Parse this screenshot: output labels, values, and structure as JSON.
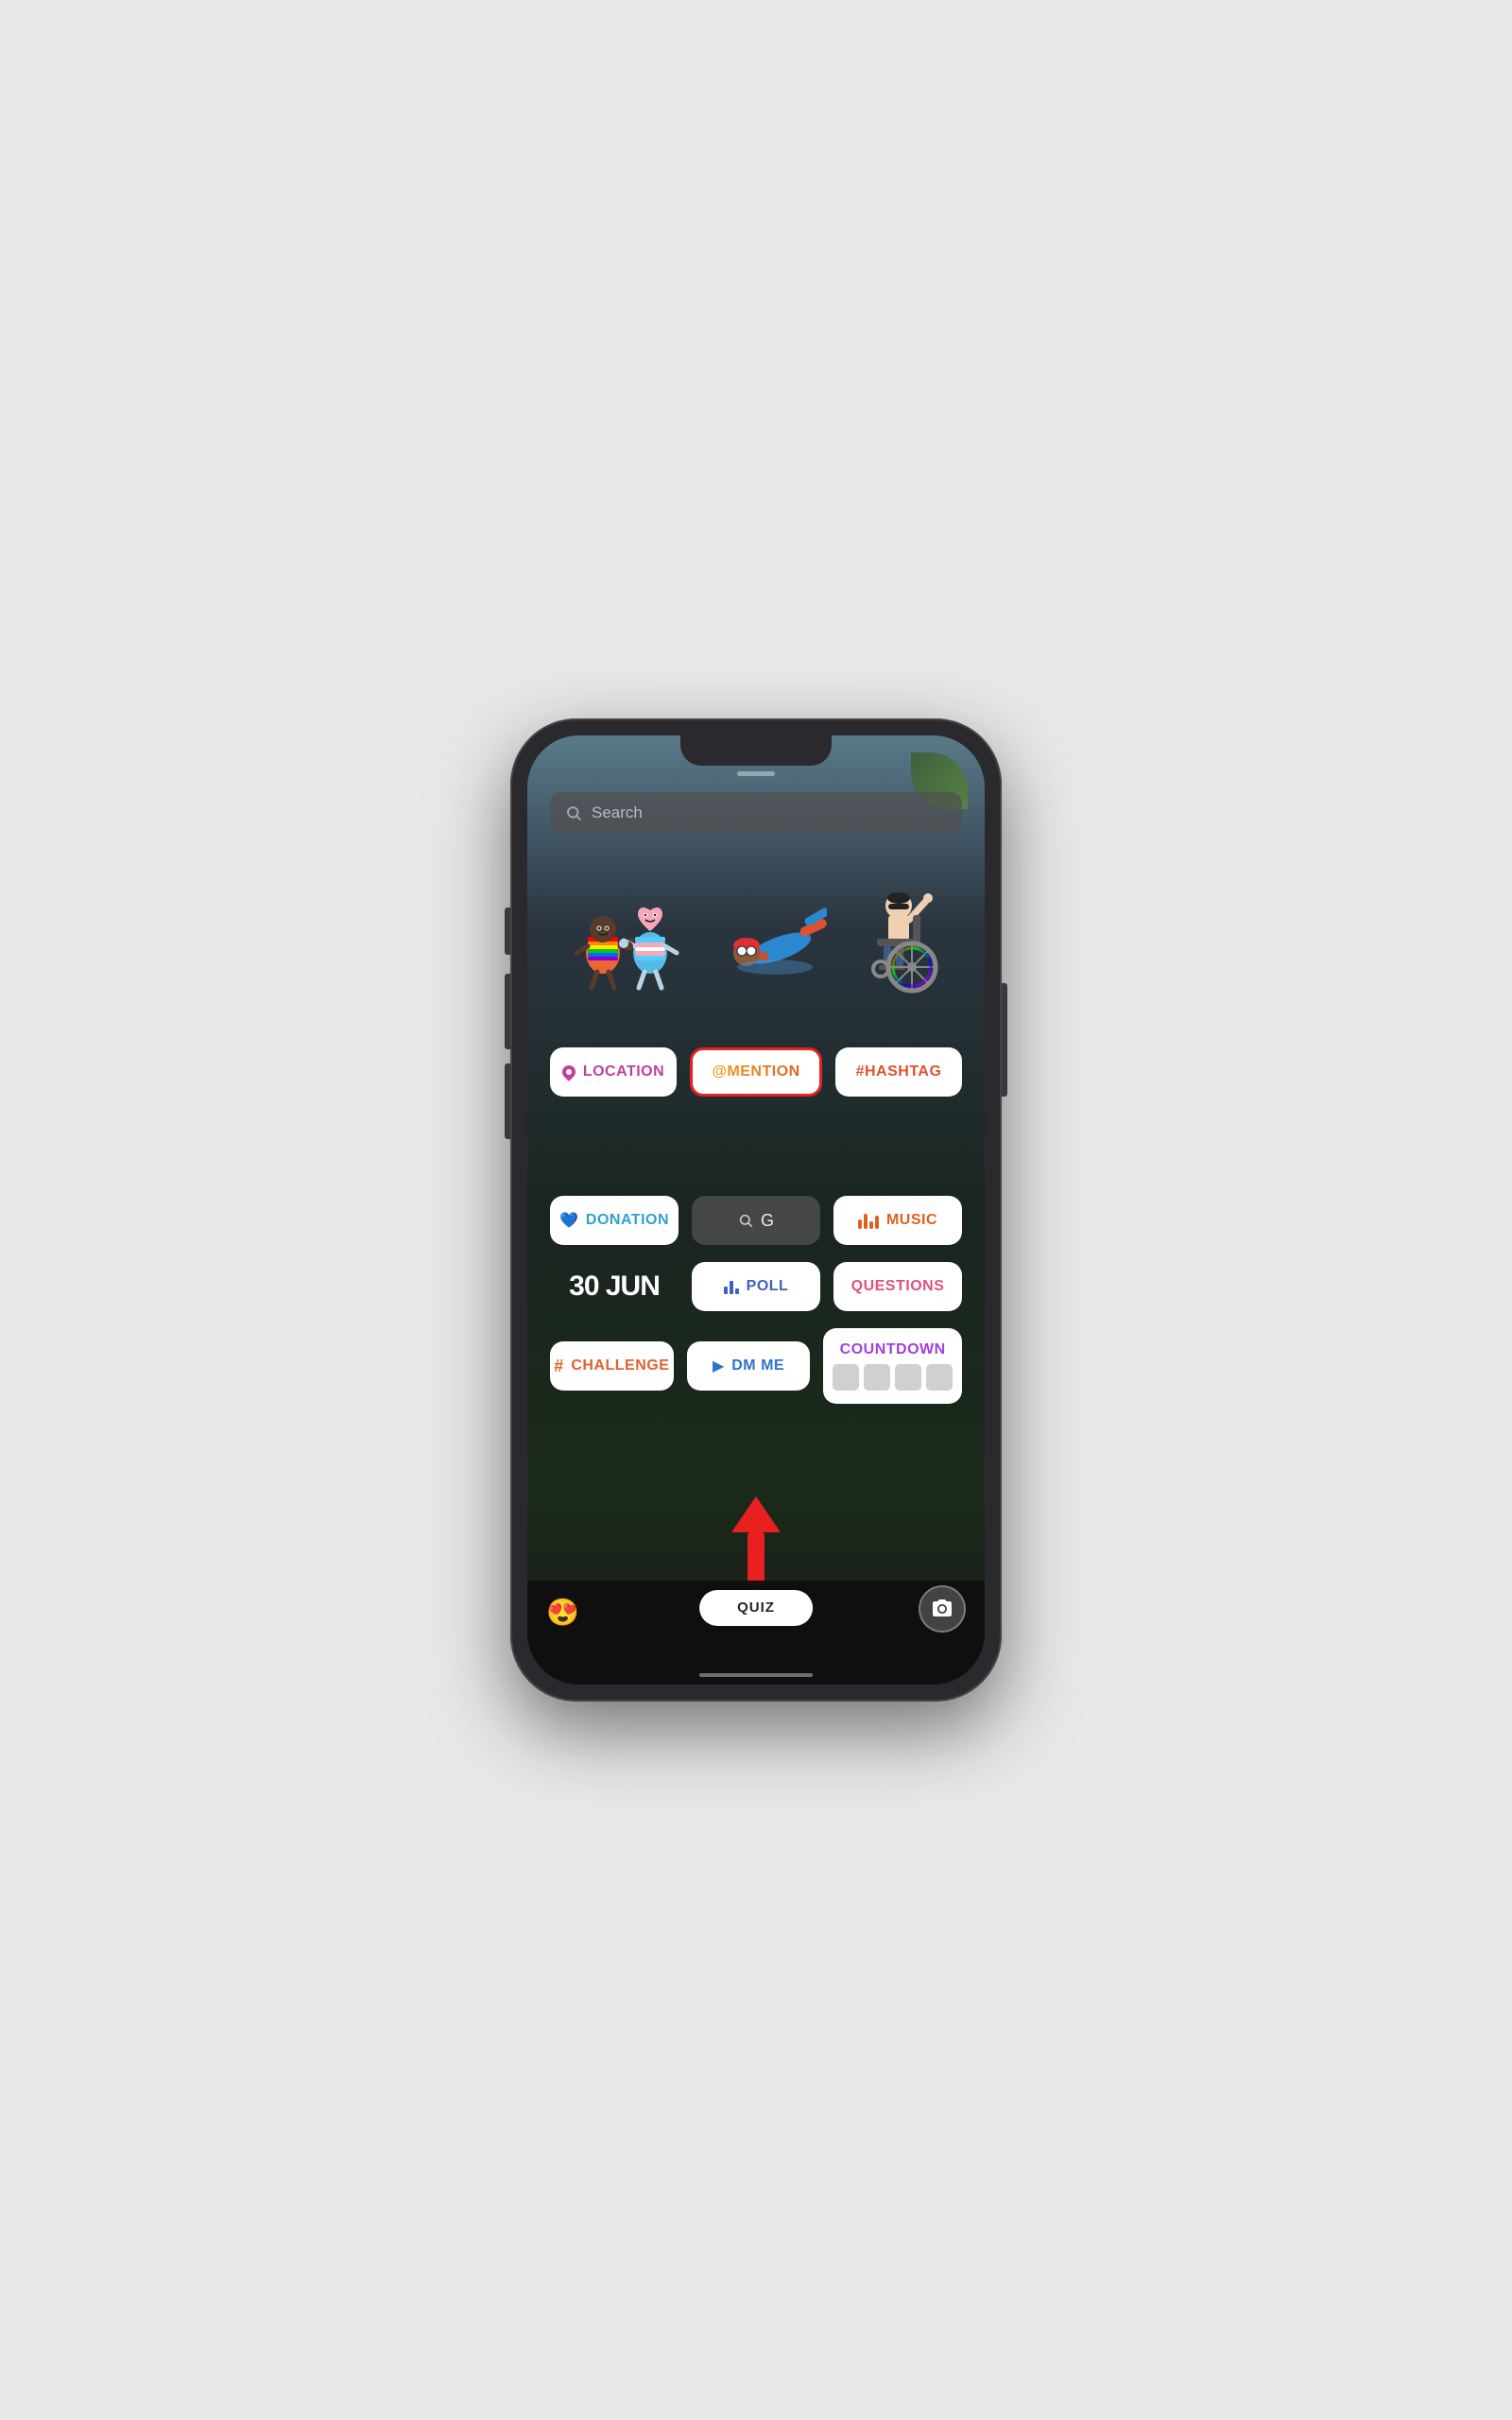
{
  "phone": {
    "screen": {
      "search": {
        "placeholder": "Search"
      },
      "stickers": {
        "section_label": "Sticker tray"
      },
      "buttons": {
        "row1": [
          {
            "id": "location",
            "label": "LOCATION",
            "icon": "location-pin-icon",
            "color": "#c040a0"
          },
          {
            "id": "mention",
            "label": "@MENTION",
            "icon": "at-icon",
            "color": "#f0a020",
            "highlighted": true
          },
          {
            "id": "hashtag",
            "label": "#HASHTAG",
            "icon": "hash-icon",
            "color": "#e05030"
          }
        ],
        "row2": [
          {
            "id": "donation",
            "label": "DONATION",
            "icon": "heart-icon",
            "color": "#30a0d0"
          },
          {
            "id": "giphy",
            "label": "G",
            "icon": "search-icon",
            "color": "rgba(255,255,255,0.9)"
          },
          {
            "id": "music",
            "label": "MUSIC",
            "icon": "music-bars-icon",
            "color": "#e06020"
          }
        ],
        "row3": [
          {
            "id": "date",
            "label": "30 JUN",
            "icon": null,
            "color": "white"
          },
          {
            "id": "poll",
            "label": "POLL",
            "icon": "list-icon",
            "color": "#4060c0"
          },
          {
            "id": "questions",
            "label": "QUESTIONS",
            "icon": null,
            "color": "#e05080"
          }
        ],
        "row4": [
          {
            "id": "challenge",
            "label": "# CHALLENGE",
            "icon": "hash-icon",
            "color": "#e06030"
          },
          {
            "id": "dmme",
            "label": "DM ME",
            "icon": "paper-plane-icon",
            "color": "#3070d0"
          },
          {
            "id": "countdown",
            "label": "COUNTDOWN",
            "icon": null,
            "color": "#a040e0"
          }
        ]
      },
      "arrow": {
        "direction": "up",
        "color": "#e82020"
      },
      "bottom_bar": {
        "quiz_label": "QUIZ",
        "emoji": "😍"
      }
    }
  }
}
